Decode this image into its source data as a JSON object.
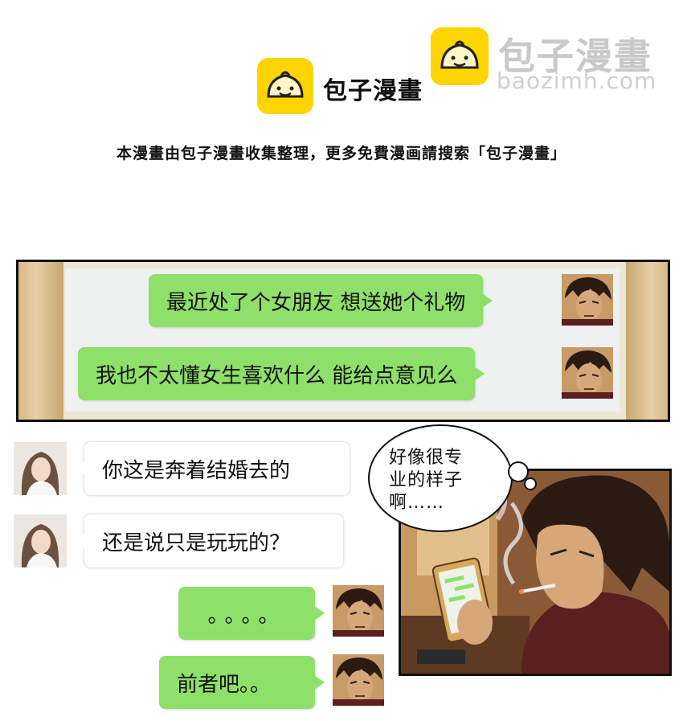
{
  "header": {
    "logo_text": "包子漫畫",
    "note": "本漫畫由包子漫畫收集整理，更多免費漫画請搜索「包子漫畫」"
  },
  "watermark": {
    "cn": "包子漫畫",
    "url": "baozimh.com"
  },
  "top_panel": {
    "messages": [
      {
        "text": "最近处了个女朋友  想送她个礼物"
      },
      {
        "text": "我也不太懂女生喜欢什么  能给点意见么"
      }
    ]
  },
  "chat": {
    "left_messages": [
      {
        "text": "你这是奔着结婚去的"
      },
      {
        "text": "还是说只是玩玩的？"
      }
    ],
    "right_messages": [
      {
        "text": "。。。。"
      },
      {
        "text": "前者吧。。"
      }
    ]
  },
  "speech": {
    "line1": "好像很专",
    "line2": "业的样子",
    "line3": "啊……"
  },
  "colors": {
    "bubble_green": "#8fe06a",
    "logo_yellow": "#ffd400"
  }
}
